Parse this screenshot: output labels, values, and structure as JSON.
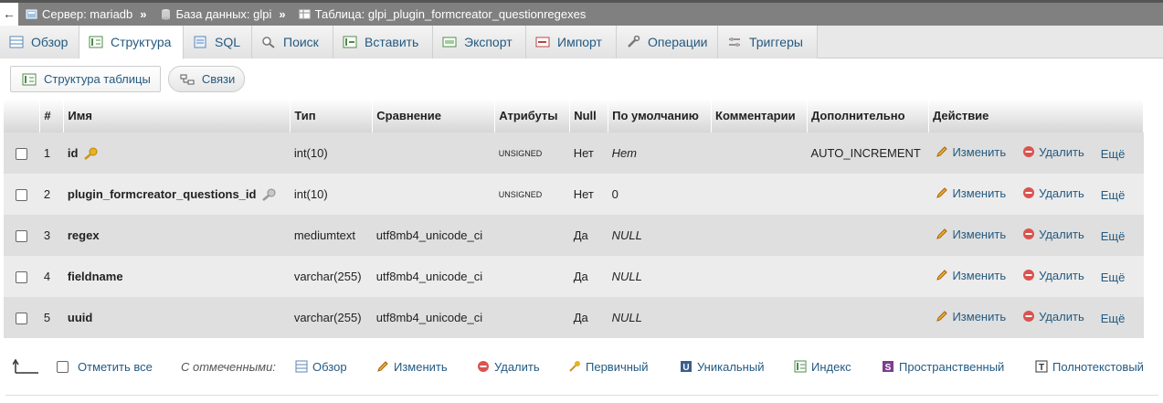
{
  "breadcrumb": {
    "back": "←",
    "server": "Сервер: mariadb",
    "database": "База данных: glpi",
    "table": "Таблица: glpi_plugin_formcreator_questionregexes",
    "separator": "»"
  },
  "tabs": [
    {
      "label": "Обзор",
      "icon": "browse-icon"
    },
    {
      "label": "Структура",
      "icon": "structure-icon"
    },
    {
      "label": "SQL",
      "icon": "sql-icon"
    },
    {
      "label": "Поиск",
      "icon": "search-icon"
    },
    {
      "label": "Вставить",
      "icon": "insert-icon"
    },
    {
      "label": "Экспорт",
      "icon": "export-icon"
    },
    {
      "label": "Импорт",
      "icon": "import-icon"
    },
    {
      "label": "Операции",
      "icon": "operations-icon"
    },
    {
      "label": "Триггеры",
      "icon": "triggers-icon"
    }
  ],
  "subtabs": {
    "table_structure": "Структура таблицы",
    "relations": "Связи"
  },
  "columns": [
    "#",
    "Имя",
    "Тип",
    "Сравнение",
    "Атрибуты",
    "Null",
    "По умолчанию",
    "Комментарии",
    "Дополнительно",
    "Действие"
  ],
  "rows": [
    {
      "num": "1",
      "name": "id",
      "key": "primary",
      "type": "int(10)",
      "collation": "",
      "attributes": "UNSIGNED",
      "null": "Нет",
      "default": "Нет",
      "default_italic": true,
      "comments": "",
      "extra": "AUTO_INCREMENT"
    },
    {
      "num": "2",
      "name": "plugin_formcreator_questions_id",
      "key": "index",
      "type": "int(10)",
      "collation": "",
      "attributes": "UNSIGNED",
      "null": "Нет",
      "default": "0",
      "default_italic": false,
      "comments": "",
      "extra": ""
    },
    {
      "num": "3",
      "name": "regex",
      "key": "",
      "type": "mediumtext",
      "collation": "utf8mb4_unicode_ci",
      "attributes": "",
      "null": "Да",
      "default": "NULL",
      "default_italic": true,
      "comments": "",
      "extra": ""
    },
    {
      "num": "4",
      "name": "fieldname",
      "key": "",
      "type": "varchar(255)",
      "collation": "utf8mb4_unicode_ci",
      "attributes": "",
      "null": "Да",
      "default": "NULL",
      "default_italic": true,
      "comments": "",
      "extra": ""
    },
    {
      "num": "5",
      "name": "uuid",
      "key": "",
      "type": "varchar(255)",
      "collation": "utf8mb4_unicode_ci",
      "attributes": "",
      "null": "Да",
      "default": "NULL",
      "default_italic": true,
      "comments": "",
      "extra": ""
    }
  ],
  "row_actions": {
    "edit": "Изменить",
    "delete": "Удалить",
    "more": "Ещё"
  },
  "bottom": {
    "check_all": "Отметить все",
    "with_selected": "С отмеченными:",
    "browse": "Обзор",
    "edit": "Изменить",
    "delete": "Удалить",
    "primary": "Первичный",
    "unique": "Уникальный",
    "index": "Индекс",
    "spatial": "Пространственный",
    "fulltext": "Полнотекстовый"
  },
  "colors": {
    "link": "#235a81",
    "breadcrumb_bg": "#808080",
    "row_odd": "#dfdfdf",
    "row_even": "#ececec",
    "delete_red": "#d9534f",
    "key_gold": "#e6b422"
  }
}
